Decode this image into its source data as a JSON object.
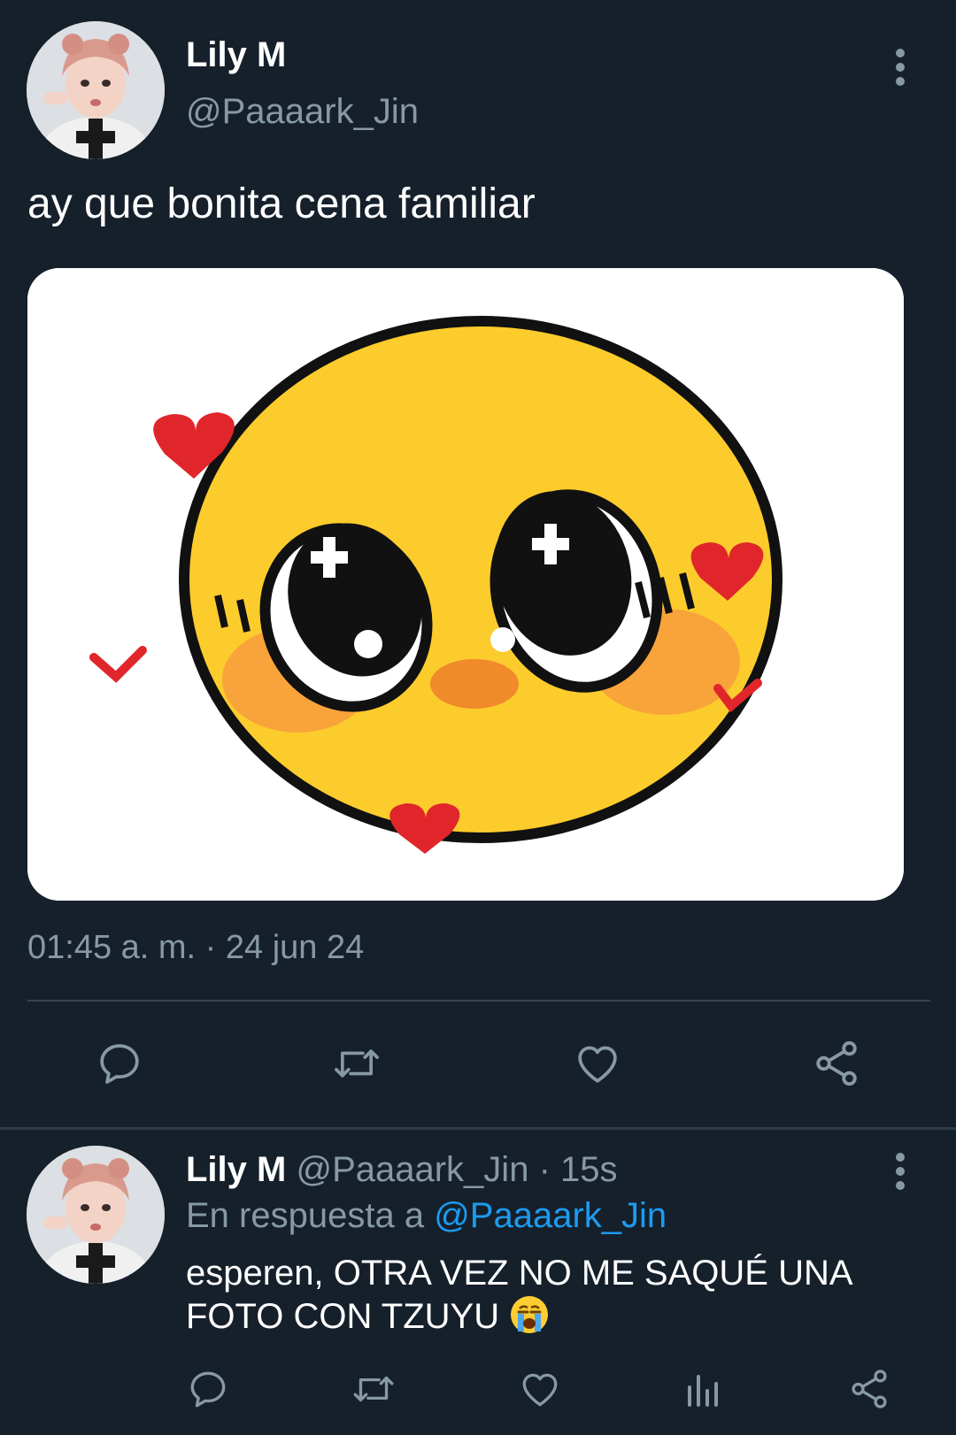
{
  "tweet": {
    "author": {
      "name": "Lily M",
      "handle": "@Paaaark_Jin"
    },
    "text": "ay que bonita cena familiar",
    "media": {
      "description_icon": "pleading-face-sticker-image"
    },
    "timestamp": "01:45 a. m. · 24 jun 24",
    "actions": [
      "reply-icon",
      "retweet-icon",
      "like-icon",
      "share-icon"
    ]
  },
  "reply": {
    "author": {
      "name": "Lily M",
      "handle": "@Paaaark_Jin"
    },
    "time": "15s",
    "separator": "·",
    "in_reply_label": "En respuesta a",
    "in_reply_mention": "@Paaaark_Jin",
    "text": "esperen, OTRA VEZ NO ME SAQUÉ UNA FOTO CON TZUYU",
    "emoji": "crying-face-emoji",
    "actions": [
      "reply-icon",
      "retweet-icon",
      "like-icon",
      "analytics-icon",
      "share-icon"
    ]
  },
  "colors": {
    "background": "#15202b",
    "muted_text": "#8899a6",
    "link": "#1d9bf0",
    "divider": "#38444d"
  }
}
